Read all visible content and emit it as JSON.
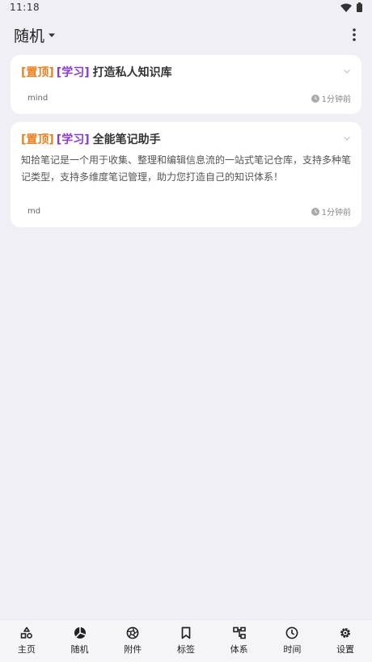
{
  "status_bar": {
    "time": "11:18"
  },
  "app_bar": {
    "title": "随机"
  },
  "notes": [
    {
      "pin_tag": "[置顶]",
      "category_tag": "[学习]",
      "title": "打造私人知识库",
      "description": "",
      "format": "mind",
      "time": "1分钟前"
    },
    {
      "pin_tag": "[置顶]",
      "category_tag": "[学习]",
      "title": "全能笔记助手",
      "description": "知拾笔记是一个用于收集、整理和编辑信息流的一站式笔记仓库，支持多种笔记类型，支持多维度笔记管理，助力您打造自己的知识体系！",
      "format": "md",
      "time": "1分钟前"
    }
  ],
  "bottom_nav": [
    {
      "label": "主页",
      "icon": "home-shapes-icon"
    },
    {
      "label": "随机",
      "icon": "shuffle-pie-icon"
    },
    {
      "label": "附件",
      "icon": "aperture-icon"
    },
    {
      "label": "标签",
      "icon": "bookmark-icon"
    },
    {
      "label": "体系",
      "icon": "hierarchy-icon"
    },
    {
      "label": "时间",
      "icon": "clock-icon"
    },
    {
      "label": "设置",
      "icon": "gear-icon"
    }
  ],
  "colors": {
    "pin_tag": "#f07d1a",
    "category_tag": "#8a38d8",
    "background": "#f0eff5",
    "card": "#ffffff"
  }
}
